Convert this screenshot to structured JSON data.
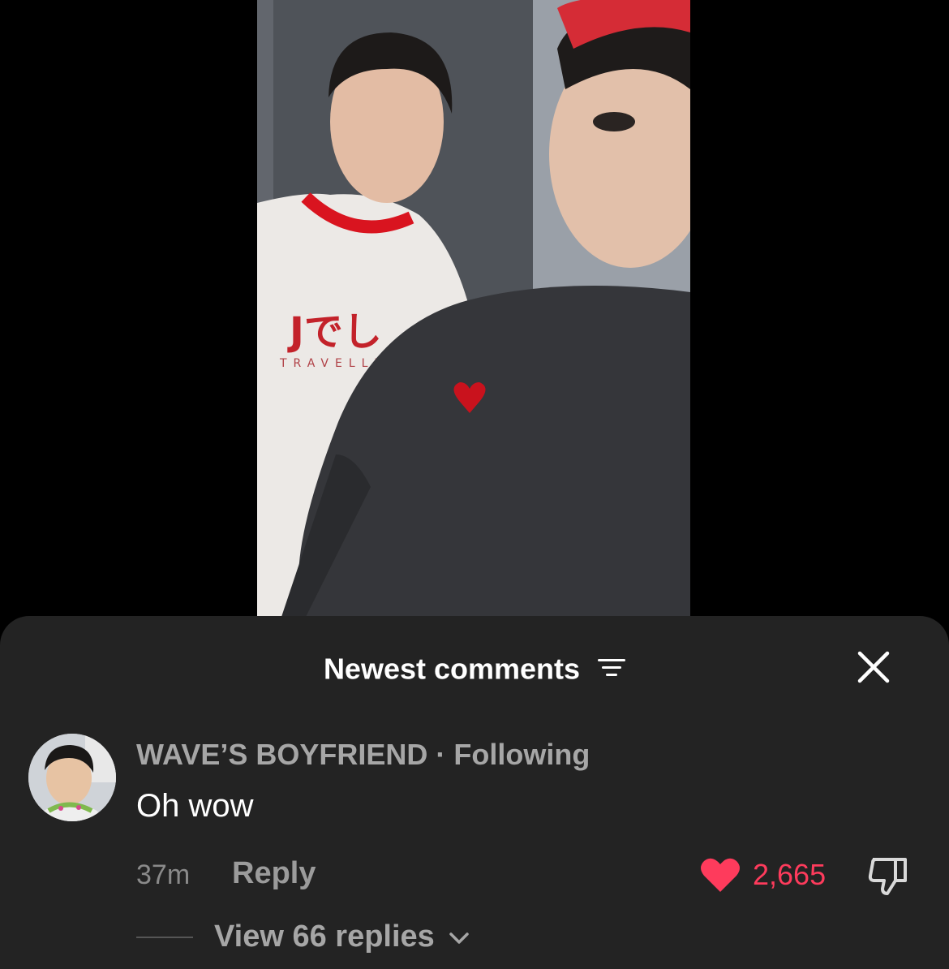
{
  "header": {
    "title": "Newest comments",
    "sort_icon": "sort-lines-icon",
    "close_icon": "close-icon"
  },
  "comment": {
    "username": "WAVE’S BOYFRIEND",
    "separator": "·",
    "follow_status": "Following",
    "text": "Oh wow",
    "time": "37m",
    "reply_label": "Reply",
    "likes": "2,665",
    "like_icon": "heart-icon",
    "dislike_icon": "thumbs-down-icon",
    "view_replies_label": "View 66 replies",
    "expand_icon": "chevron-down-icon"
  },
  "video": {
    "shirt_logo": "Jでし",
    "shirt_sub": "TRAVELLER"
  },
  "colors": {
    "sheet_bg": "#232323",
    "like_red": "#fe3b5c",
    "muted_text": "#a6a6a6"
  }
}
